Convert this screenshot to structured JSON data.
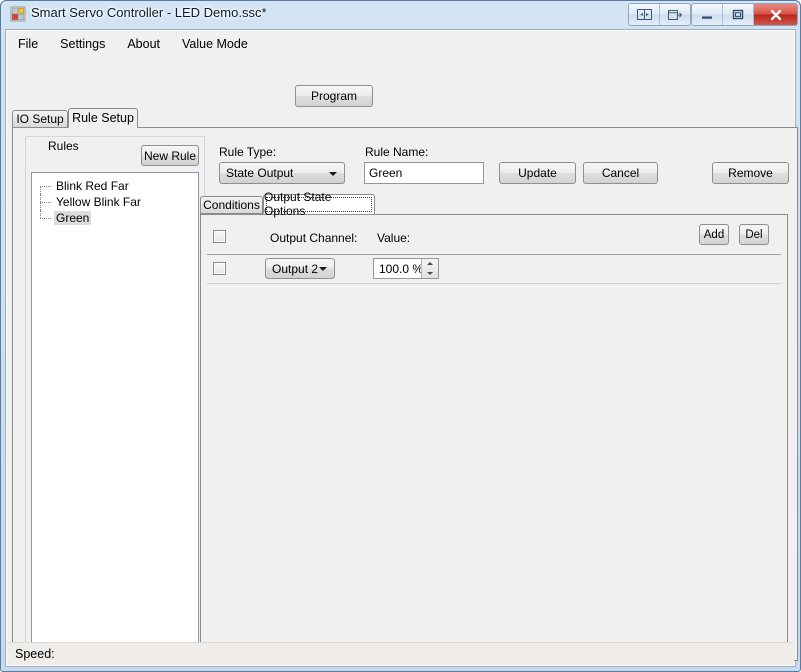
{
  "window": {
    "title": "Smart Servo Controller - LED Demo.ssc*",
    "app_icon": "app-squares-icon",
    "caption_buttons": [
      {
        "name": "split-view-button",
        "glyph": "split-icon"
      },
      {
        "name": "new-window-button",
        "glyph": "window-icon"
      },
      {
        "name": "minimize-button",
        "glyph": "minimize-icon"
      },
      {
        "name": "maximize-button",
        "glyph": "maximize-icon"
      },
      {
        "name": "close-button",
        "glyph": "close-icon"
      }
    ],
    "accent_close": "#b5261c",
    "frame_color": "#cfe0f2"
  },
  "menubar": {
    "items": [
      {
        "label": "File"
      },
      {
        "label": "Settings"
      },
      {
        "label": "About"
      },
      {
        "label": "Value Mode"
      }
    ]
  },
  "toolbar": {
    "program_label": "Program"
  },
  "main_tabs": [
    {
      "label": "IO Setup",
      "active": false
    },
    {
      "label": "Rule Setup",
      "active": true
    }
  ],
  "rules_group": {
    "legend": "Rules",
    "new_rule_label": "New Rule",
    "tree_items": [
      {
        "label": "Blink Red Far",
        "selected": false
      },
      {
        "label": "Yellow Blink Far",
        "selected": false
      },
      {
        "label": "Green",
        "selected": true
      }
    ]
  },
  "rule_editor": {
    "rule_type_label": "Rule Type:",
    "rule_type_value": "State Output",
    "rule_name_label": "Rule Name:",
    "rule_name_value": "Green",
    "update_label": "Update",
    "cancel_label": "Cancel",
    "remove_label": "Remove"
  },
  "inner_tabs": [
    {
      "label": "Conditions",
      "active": false
    },
    {
      "label": "Output State Options",
      "active": true
    }
  ],
  "output_grid": {
    "add_label": "Add",
    "del_label": "Del",
    "headers": {
      "output_channel": "Output Channel:",
      "value": "Value:"
    },
    "rows": [
      {
        "channel": "Output 2",
        "value": "100.0 %"
      }
    ]
  },
  "statusbar": {
    "speed_label": "Speed:"
  }
}
